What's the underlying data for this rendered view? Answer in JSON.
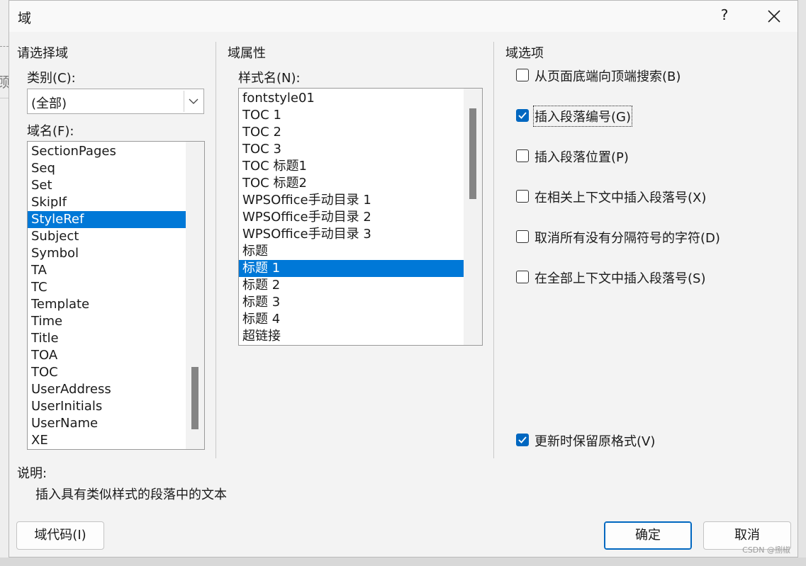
{
  "dialog": {
    "title": "域",
    "help_label": "?",
    "left": {
      "section_title": "请选择域",
      "category_label": "类别(C):",
      "category_value": "(全部)",
      "field_names_label": "域名(F):",
      "field_names": [
        "SectionPages",
        "Seq",
        "Set",
        "SkipIf",
        "StyleRef",
        "Subject",
        "Symbol",
        "TA",
        "TC",
        "Template",
        "Time",
        "Title",
        "TOA",
        "TOC",
        "UserAddress",
        "UserInitials",
        "UserName",
        "XE"
      ],
      "selected_field": "StyleRef"
    },
    "middle": {
      "section_title": "域属性",
      "style_name_label": "样式名(N):",
      "styles": [
        "fontstyle01",
        "TOC 1",
        "TOC 2",
        "TOC 3",
        "TOC 标题1",
        "TOC 标题2",
        "WPSOffice手动目录 1",
        "WPSOffice手动目录 2",
        "WPSOffice手动目录 3",
        "标题",
        "标题 1",
        "标题 2",
        "标题 3",
        "标题 4",
        "超链接"
      ],
      "selected_style": "标题 1"
    },
    "right": {
      "section_title": "域选项",
      "options": [
        {
          "label": "从页面底端向顶端搜索(B)",
          "checked": false
        },
        {
          "label": "插入段落编号(G)",
          "checked": true
        },
        {
          "label": "插入段落位置(P)",
          "checked": false
        },
        {
          "label": "在相关上下文中插入段落号(X)",
          "checked": false
        },
        {
          "label": "取消所有没有分隔符号的字符(D)",
          "checked": false
        },
        {
          "label": "在全部上下文中插入段落号(S)",
          "checked": false
        }
      ],
      "preserve_format": {
        "label": "更新时保留原格式(V)",
        "checked": true
      }
    },
    "description": {
      "title": "说明:",
      "text": "插入具有类似样式的段落中的文本"
    },
    "buttons": {
      "field_codes": "域代码(I)",
      "ok": "确定",
      "cancel": "取消"
    },
    "watermark": "CSDN @捌椒"
  },
  "background": {
    "fragment_text": "顾"
  },
  "colors": {
    "accent": "#0078d7",
    "checkbox": "#0067c0"
  }
}
